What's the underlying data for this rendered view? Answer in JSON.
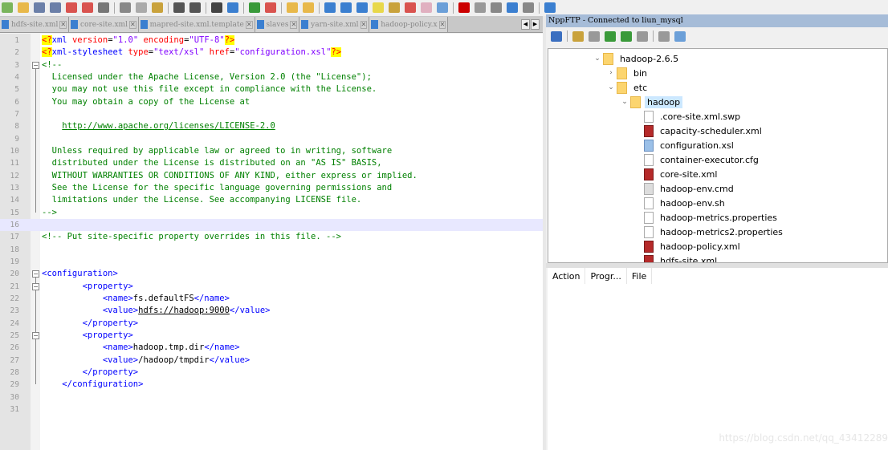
{
  "toolbar": {
    "icons": [
      "new-icon",
      "open-icon",
      "save-icon",
      "save-all-icon",
      "close-icon",
      "close-all-icon",
      "print-icon",
      "cut-icon",
      "copy-icon",
      "paste-icon",
      "undo-icon",
      "redo-icon",
      "find-icon",
      "replace-icon",
      "zoom-in-icon",
      "zoom-out-icon",
      "sync-v-icon",
      "sync-h-icon",
      "wrap-icon",
      "all-chars-icon",
      "indent-guide-icon",
      "udl-icon",
      "doc-map-icon",
      "function-list-icon",
      "folder-workspace-icon",
      "monitor-icon",
      "record-icon",
      "stop-icon",
      "play-icon",
      "play-multi-icon",
      "save-macro-icon",
      "nppftp-icon"
    ]
  },
  "tabs": [
    {
      "label": "hdfs-site.xml"
    },
    {
      "label": "core-site.xml"
    },
    {
      "label": "mapred-site.xml.template"
    },
    {
      "label": "slaves"
    },
    {
      "label": "yarn-site.xml"
    },
    {
      "label": "hadoop-policy.x"
    }
  ],
  "editor": {
    "current_line": 16,
    "lines": [
      [
        [
          "pi",
          "<?"
        ],
        [
          "tag",
          "xml "
        ],
        [
          "attr",
          "version"
        ],
        [
          "txt",
          "="
        ],
        [
          "str",
          "\"1.0\" "
        ],
        [
          "attr",
          "encoding"
        ],
        [
          "txt",
          "="
        ],
        [
          "str",
          "\"UTF-8\""
        ],
        [
          "pi",
          "?>"
        ]
      ],
      [
        [
          "pi",
          "<?"
        ],
        [
          "tag",
          "xml-stylesheet "
        ],
        [
          "attr",
          "type"
        ],
        [
          "txt",
          "="
        ],
        [
          "str",
          "\"text/xsl\" "
        ],
        [
          "attr",
          "href"
        ],
        [
          "txt",
          "="
        ],
        [
          "str",
          "\"configuration.xsl\""
        ],
        [
          "pi",
          "?>"
        ]
      ],
      [
        [
          "cmt",
          "<!--"
        ]
      ],
      [
        [
          "cmt",
          "  Licensed under the Apache License, Version 2.0 (the \"License\");"
        ]
      ],
      [
        [
          "cmt",
          "  you may not use this file except in compliance with the License."
        ]
      ],
      [
        [
          "cmt",
          "  You may obtain a copy of the License at"
        ]
      ],
      [],
      [
        [
          "cmt",
          "    "
        ],
        [
          "link",
          "http://www.apache.org/licenses/LICENSE-2.0"
        ]
      ],
      [],
      [
        [
          "cmt",
          "  Unless required by applicable law or agreed to in writing, software"
        ]
      ],
      [
        [
          "cmt",
          "  distributed under the License is distributed on an \"AS IS\" BASIS,"
        ]
      ],
      [
        [
          "cmt",
          "  WITHOUT WARRANTIES OR CONDITIONS OF ANY KIND, either express or implied."
        ]
      ],
      [
        [
          "cmt",
          "  See the License for the specific language governing permissions and"
        ]
      ],
      [
        [
          "cmt",
          "  limitations under the License. See accompanying LICENSE file."
        ]
      ],
      [
        [
          "cmt",
          "-->"
        ]
      ],
      [],
      [
        [
          "cmt",
          "<!-- Put site-specific property overrides in this file. -->"
        ]
      ],
      [],
      [],
      [
        [
          "tag",
          "<configuration>"
        ]
      ],
      [
        [
          "txt",
          "        "
        ],
        [
          "tag",
          "<property>"
        ]
      ],
      [
        [
          "txt",
          "            "
        ],
        [
          "tag",
          "<name>"
        ],
        [
          "txt",
          "fs.defaultFS"
        ],
        [
          "tag",
          "</name>"
        ]
      ],
      [
        [
          "txt",
          "            "
        ],
        [
          "tag",
          "<value>"
        ],
        [
          "val",
          "hdfs://hadoop:9000"
        ],
        [
          "tag",
          "</value>"
        ]
      ],
      [
        [
          "txt",
          "        "
        ],
        [
          "tag",
          "</property>"
        ]
      ],
      [
        [
          "txt",
          "        "
        ],
        [
          "tag",
          "<property>"
        ]
      ],
      [
        [
          "txt",
          "            "
        ],
        [
          "tag",
          "<name>"
        ],
        [
          "txt",
          "hadoop.tmp.dir"
        ],
        [
          "tag",
          "</name>"
        ]
      ],
      [
        [
          "txt",
          "            "
        ],
        [
          "tag",
          "<value>"
        ],
        [
          "txt",
          "/hadoop/tmpdir"
        ],
        [
          "tag",
          "</value>"
        ]
      ],
      [
        [
          "txt",
          "        "
        ],
        [
          "tag",
          "</property>"
        ]
      ],
      [
        [
          "txt",
          "    "
        ],
        [
          "tag",
          "</configuration>"
        ]
      ],
      [],
      []
    ]
  },
  "ftp": {
    "title": "NppFTP - Connected to liun_mysql",
    "tools": [
      "connect-icon",
      "open-dir-icon",
      "download-icon",
      "upload-icon",
      "refresh-icon",
      "abort-icon",
      "settings-icon",
      "message-window-icon"
    ],
    "tree": [
      {
        "label": "hadoop-2.6.5",
        "type": "folder",
        "depth": 0,
        "state": "open"
      },
      {
        "label": "bin",
        "type": "folder",
        "depth": 1,
        "state": "closed"
      },
      {
        "label": "etc",
        "type": "folder",
        "depth": 1,
        "state": "open"
      },
      {
        "label": "hadoop",
        "type": "folder",
        "depth": 2,
        "state": "open",
        "selected": true
      },
      {
        "label": ".core-site.xml.swp",
        "type": "file",
        "depth": 3
      },
      {
        "label": "capacity-scheduler.xml",
        "type": "xml",
        "depth": 3
      },
      {
        "label": "configuration.xsl",
        "type": "xsl",
        "depth": 3
      },
      {
        "label": "container-executor.cfg",
        "type": "file",
        "depth": 3
      },
      {
        "label": "core-site.xml",
        "type": "xml",
        "depth": 3
      },
      {
        "label": "hadoop-env.cmd",
        "type": "cmd",
        "depth": 3
      },
      {
        "label": "hadoop-env.sh",
        "type": "file",
        "depth": 3
      },
      {
        "label": "hadoop-metrics.properties",
        "type": "file",
        "depth": 3
      },
      {
        "label": "hadoop-metrics2.properties",
        "type": "file",
        "depth": 3
      },
      {
        "label": "hadoop-policy.xml",
        "type": "xml",
        "depth": 3
      },
      {
        "label": "hdfs-site.xml",
        "type": "xml",
        "depth": 3
      }
    ],
    "queue_columns": [
      "Action",
      "Progr...",
      "File"
    ]
  },
  "watermark": "https://blog.csdn.net/qq_43412289"
}
